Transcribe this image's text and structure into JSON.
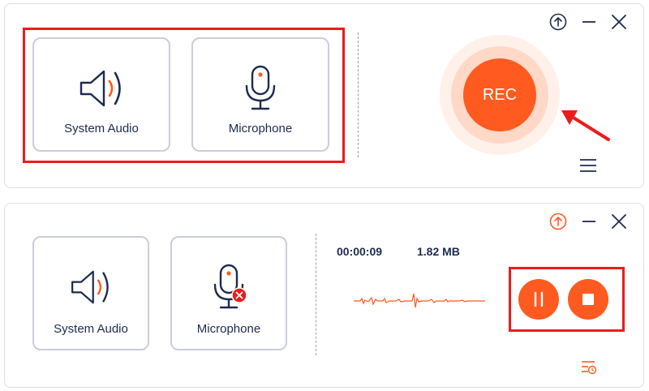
{
  "top_panel": {
    "system_audio_label": "System Audio",
    "microphone_label": "Microphone",
    "rec_label": "REC",
    "icons": {
      "upload": "upload-circle-icon",
      "minimize": "minimize-icon",
      "close": "close-icon",
      "menu": "hamburger-menu-icon",
      "speaker": "speaker-icon",
      "microphone": "microphone-icon"
    }
  },
  "bottom_panel": {
    "system_audio_label": "System Audio",
    "microphone_label": "Microphone",
    "elapsed_time": "00:00:09",
    "file_size": "1.82 MB",
    "icons": {
      "upload": "upload-circle-icon",
      "minimize": "minimize-icon",
      "close": "close-icon",
      "pause": "pause-icon",
      "stop": "stop-icon",
      "schedule": "task-schedule-icon",
      "microphone_muted": "microphone-muted-icon"
    }
  },
  "colors": {
    "accent": "#ff5a1f",
    "highlight_box": "#ee1b1b",
    "text": "#1d2b4f",
    "card_border": "#c9ced9"
  }
}
